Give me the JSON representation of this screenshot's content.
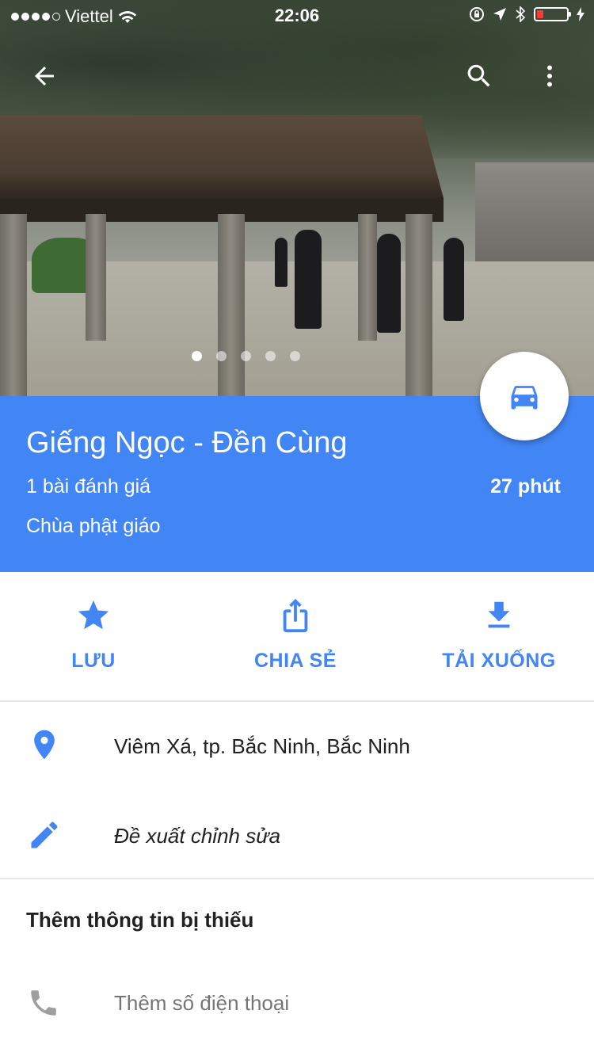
{
  "status_bar": {
    "carrier": "Viettel",
    "time": "22:06",
    "signal_bars": 4,
    "battery_level_fraction": 0.15
  },
  "top_bar": {
    "back_icon": "arrow-back-icon",
    "search_icon": "search-icon",
    "more_icon": "more-vert-icon"
  },
  "photo": {
    "page_count": 5,
    "active_page": 1
  },
  "place": {
    "name": "Giếng Ngọc - Đền Cùng",
    "reviews": "1 bài đánh giá",
    "travel_time": "27 phút",
    "category": "Chùa phật giáo"
  },
  "directions_button": {
    "icon": "car-icon"
  },
  "actions": [
    {
      "label": "LƯU",
      "icon": "star-icon"
    },
    {
      "label": "CHIA SẺ",
      "icon": "share-icon"
    },
    {
      "label": "TẢI XUỐNG",
      "icon": "download-icon"
    }
  ],
  "details": {
    "address": "Viêm Xá, tp. Bắc Ninh, Bắc Ninh",
    "suggest_edit": "Đề xuất chỉnh sửa"
  },
  "missing_info": {
    "title": "Thêm thông tin bị thiếu",
    "add_phone": "Thêm số điện thoại"
  },
  "colors": {
    "accent": "#4285f4",
    "icon_gray": "#757575"
  }
}
